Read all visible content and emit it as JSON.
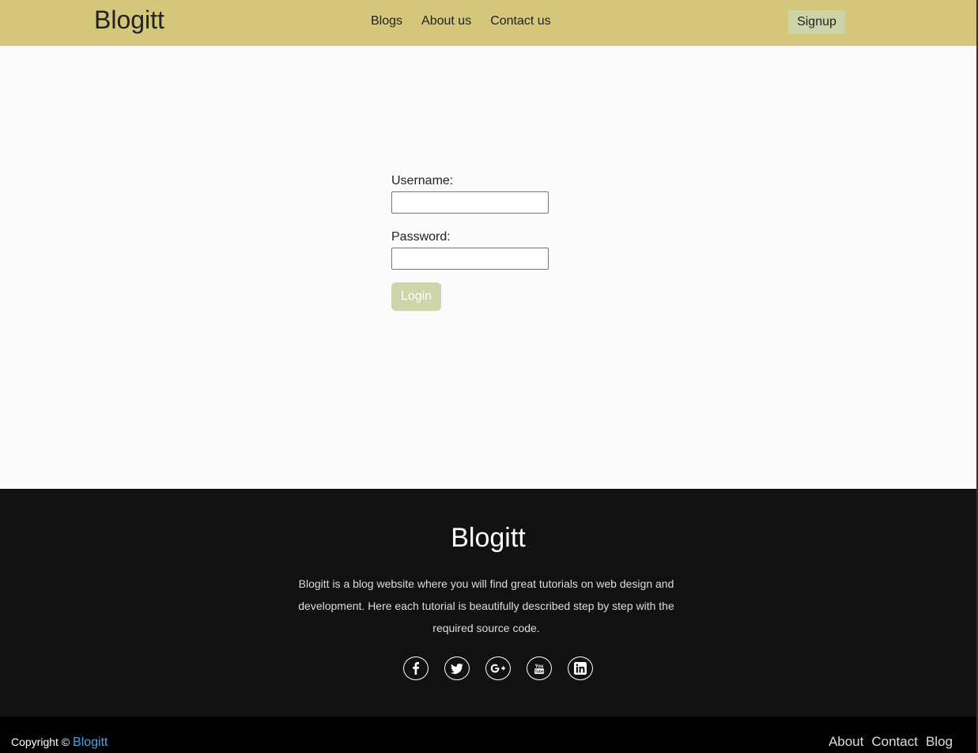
{
  "header": {
    "logo": "Blogitt",
    "nav": [
      "Blogs",
      "About us",
      "Contact us"
    ],
    "signup_label": "Signup",
    "bg_color": "#d4c77c"
  },
  "login": {
    "username_label": "Username:",
    "username_value": "",
    "password_label": "Password:",
    "password_value": "",
    "login_label": "Login"
  },
  "footer": {
    "title": "Blogitt",
    "description": "Blogitt is a blog website where you will find great tutorials on web design and development. Here each tutorial is beautifully described step by step with the required source code.",
    "socials": [
      "facebook-icon",
      "twitter-icon",
      "google-plus-icon",
      "youtube-icon",
      "linkedin-icon"
    ],
    "copyright_prefix": "Copyright ©",
    "copyright_brand": "Blogitt",
    "bottom_links": [
      "About",
      "Contact",
      "Blog"
    ]
  }
}
